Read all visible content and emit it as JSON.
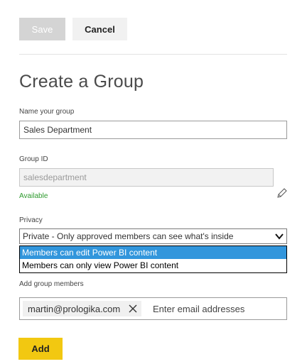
{
  "toolbar": {
    "save_label": "Save",
    "cancel_label": "Cancel"
  },
  "form": {
    "title": "Create a Group",
    "name_label": "Name your group",
    "name_value": "Sales Department",
    "groupid_label": "Group ID",
    "groupid_value": "salesdepartment",
    "availability": "Available",
    "privacy_label": "Privacy",
    "privacy_value": "Private - Only approved members can see what's inside",
    "dropdown_options": [
      {
        "label": "Members can edit Power BI content",
        "selected": true
      },
      {
        "label": "Members can only view Power BI content",
        "selected": false
      }
    ],
    "members_label": "Add group members",
    "member_chip": "martin@prologika.com",
    "email_placeholder": "Enter email addresses",
    "add_label": "Add"
  },
  "colors": {
    "accent_yellow": "#f2c811",
    "selected_blue": "#3296dc",
    "available_green": "#2e9a2e"
  },
  "icons": [
    "pencil-icon",
    "chevron-down-icon",
    "close-icon"
  ]
}
